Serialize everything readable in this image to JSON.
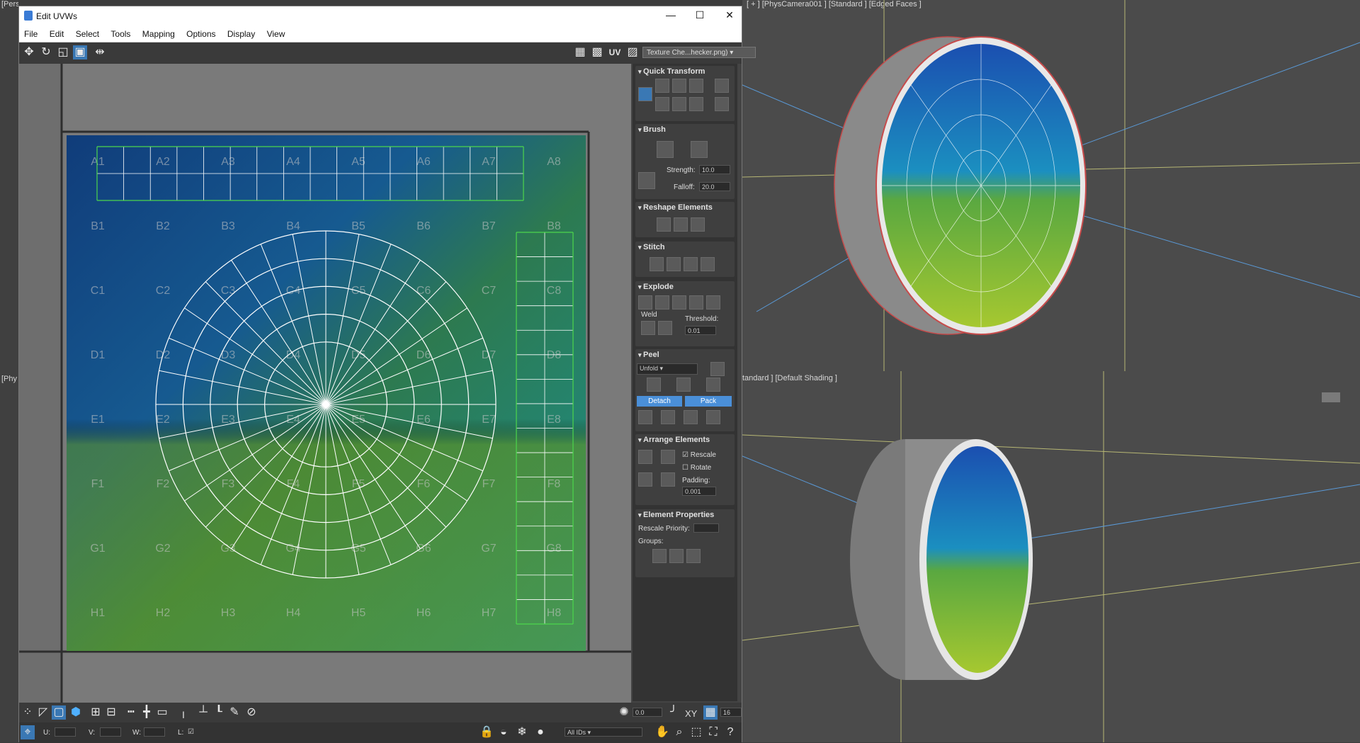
{
  "viewports": {
    "top_left_label": "[Perspective ] [Standard ] [Edged Faces ]",
    "top_right_label": "[ + ] [PhysCamera001 ] [Standard ] [Edged Faces ]",
    "bottom_right_label": "tandard ] [Default Shading ]",
    "left_mid_label": "[Phy"
  },
  "window": {
    "title": "Edit UVWs",
    "minimize": "—",
    "maximize": "☐",
    "close": "✕"
  },
  "menu": [
    "File",
    "Edit",
    "Select",
    "Tools",
    "Mapping",
    "Options",
    "Display",
    "View"
  ],
  "toolbar": {
    "uv_label": "UV",
    "texture_dropdown": "Texture Che...hecker.png)"
  },
  "checker": {
    "rows": [
      "A",
      "B",
      "C",
      "D",
      "E",
      "F",
      "G",
      "H"
    ],
    "cols": [
      "1",
      "2",
      "3",
      "4",
      "5",
      "6",
      "7",
      "8"
    ]
  },
  "panel": {
    "quick_transform": "Quick Transform",
    "brush": "Brush",
    "strength_label": "Strength:",
    "strength_value": "10.0",
    "falloff_label": "Falloff:",
    "falloff_value": "20.0",
    "reshape": "Reshape Elements",
    "stitch": "Stitch",
    "explode": "Explode",
    "weld_label": "Weld",
    "threshold_label": "Threshold:",
    "threshold_value": "0.01",
    "peel": "Peel",
    "peel_mode": "Unfold",
    "detach": "Detach",
    "pack": "Pack",
    "arrange": "Arrange Elements",
    "rescale": "Rescale",
    "rotate": "Rotate",
    "padding_label": "Padding:",
    "padding_value": "0.001",
    "element_props": "Element Properties",
    "rescale_priority": "Rescale Priority:",
    "groups": "Groups:"
  },
  "bottom": {
    "zoom_value": "0.0",
    "xy_label": "XY",
    "grid_value": "16",
    "u_label": "U:",
    "v_label": "V:",
    "w_label": "W:",
    "l_label": "L:",
    "ids_dropdown": "All IDs"
  },
  "colors": {
    "accent": "#3a78b4",
    "uv_wire": "#ffffff",
    "selected_wire": "#4cd64c"
  }
}
